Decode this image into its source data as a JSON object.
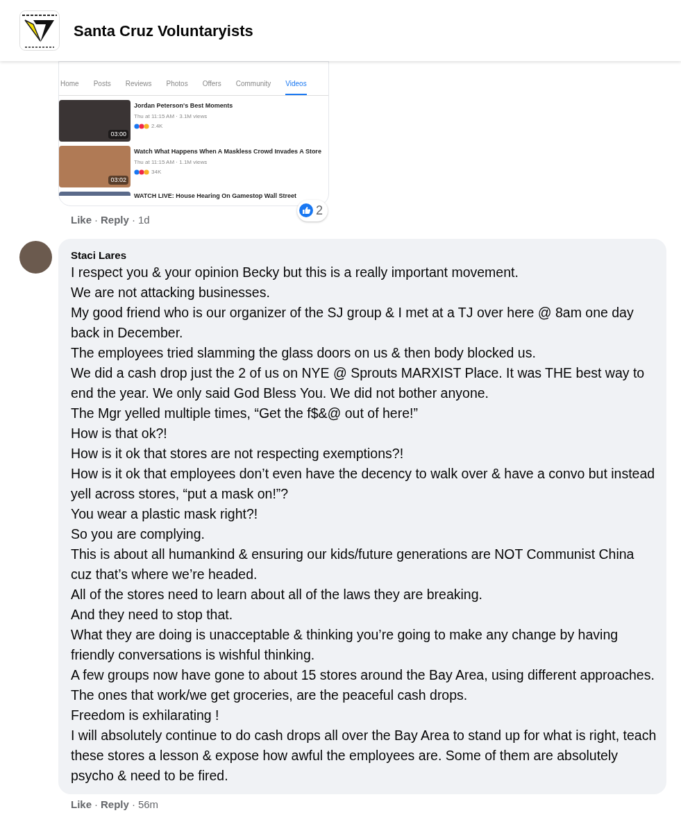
{
  "group": {
    "name": "Santa Cruz Voluntaryists"
  },
  "shared_screenshot": {
    "tabs": [
      {
        "label": "Home",
        "selected": false
      },
      {
        "label": "Posts",
        "selected": false
      },
      {
        "label": "Reviews",
        "selected": false
      },
      {
        "label": "Photos",
        "selected": false
      },
      {
        "label": "Offers",
        "selected": false
      },
      {
        "label": "Community",
        "selected": false
      },
      {
        "label": "Videos",
        "selected": true
      }
    ],
    "videos": [
      {
        "title": "Jordan Peterson's Best Moments",
        "meta": "Thu at 11:15 AM · 3.1M views",
        "reactions": "2.4K",
        "duration": "03:00"
      },
      {
        "title": "Watch What Happens When A Maskless Crowd Invades A Store",
        "meta": "Thu at 11:15 AM · 1.1M views",
        "reactions": "34K",
        "duration": "03:02"
      }
    ],
    "cut_item": "WATCH LIVE: House Hearing On Gamestop Wall Street"
  },
  "first_comment": {
    "like": "Like",
    "sep1": "·",
    "reply": "Reply",
    "sep2": "·",
    "time": "1d",
    "reaction_count": "2"
  },
  "comment": {
    "author": "Staci Lares",
    "lines": [
      "I respect you & your opinion Becky but this is a really important movement.",
      "We are not attacking businesses.",
      "My good friend who is our organizer of the SJ group & I met at a TJ over here @ 8am one day back in December.",
      "The employees tried slamming the glass doors on us & then body blocked us.",
      "We did a cash drop just the 2 of us on NYE @ Sprouts MARXIST Place. It was THE best way to end the year. We only said God Bless You. We did not bother anyone.",
      "The Mgr yelled multiple times, “Get the f$&@ out of here!”",
      "How is that ok?!",
      "How is it ok that stores are not respecting exemptions?!",
      "How is it ok that employees don’t even have the decency to walk over & have a convo but instead yell across stores, “put a mask on!”?",
      "You wear a plastic mask right?!",
      "So you are complying.",
      "This is about all humankind & ensuring our kids/future generations are NOT Communist China cuz that’s where we’re headed.",
      "All of the stores need to learn about all of the laws they are breaking.",
      "And they need to stop that.",
      "What they are doing is unacceptable & thinking you’re going to make any change by having friendly conversations is wishful thinking.",
      "A few groups now have gone to about 15 stores around the Bay Area, using different approaches.",
      "The ones that work/we get groceries, are the peaceful cash drops.",
      "Freedom is exhilarating !",
      "I will absolutely continue to do cash drops all over the Bay Area to stand up for what is right, teach these stores a lesson & expose how awful the employees are. Some of them are absolutely psycho & need to be fired."
    ],
    "like": "Like",
    "sep1": "·",
    "reply": "Reply",
    "sep2": "·",
    "time": "56m"
  }
}
